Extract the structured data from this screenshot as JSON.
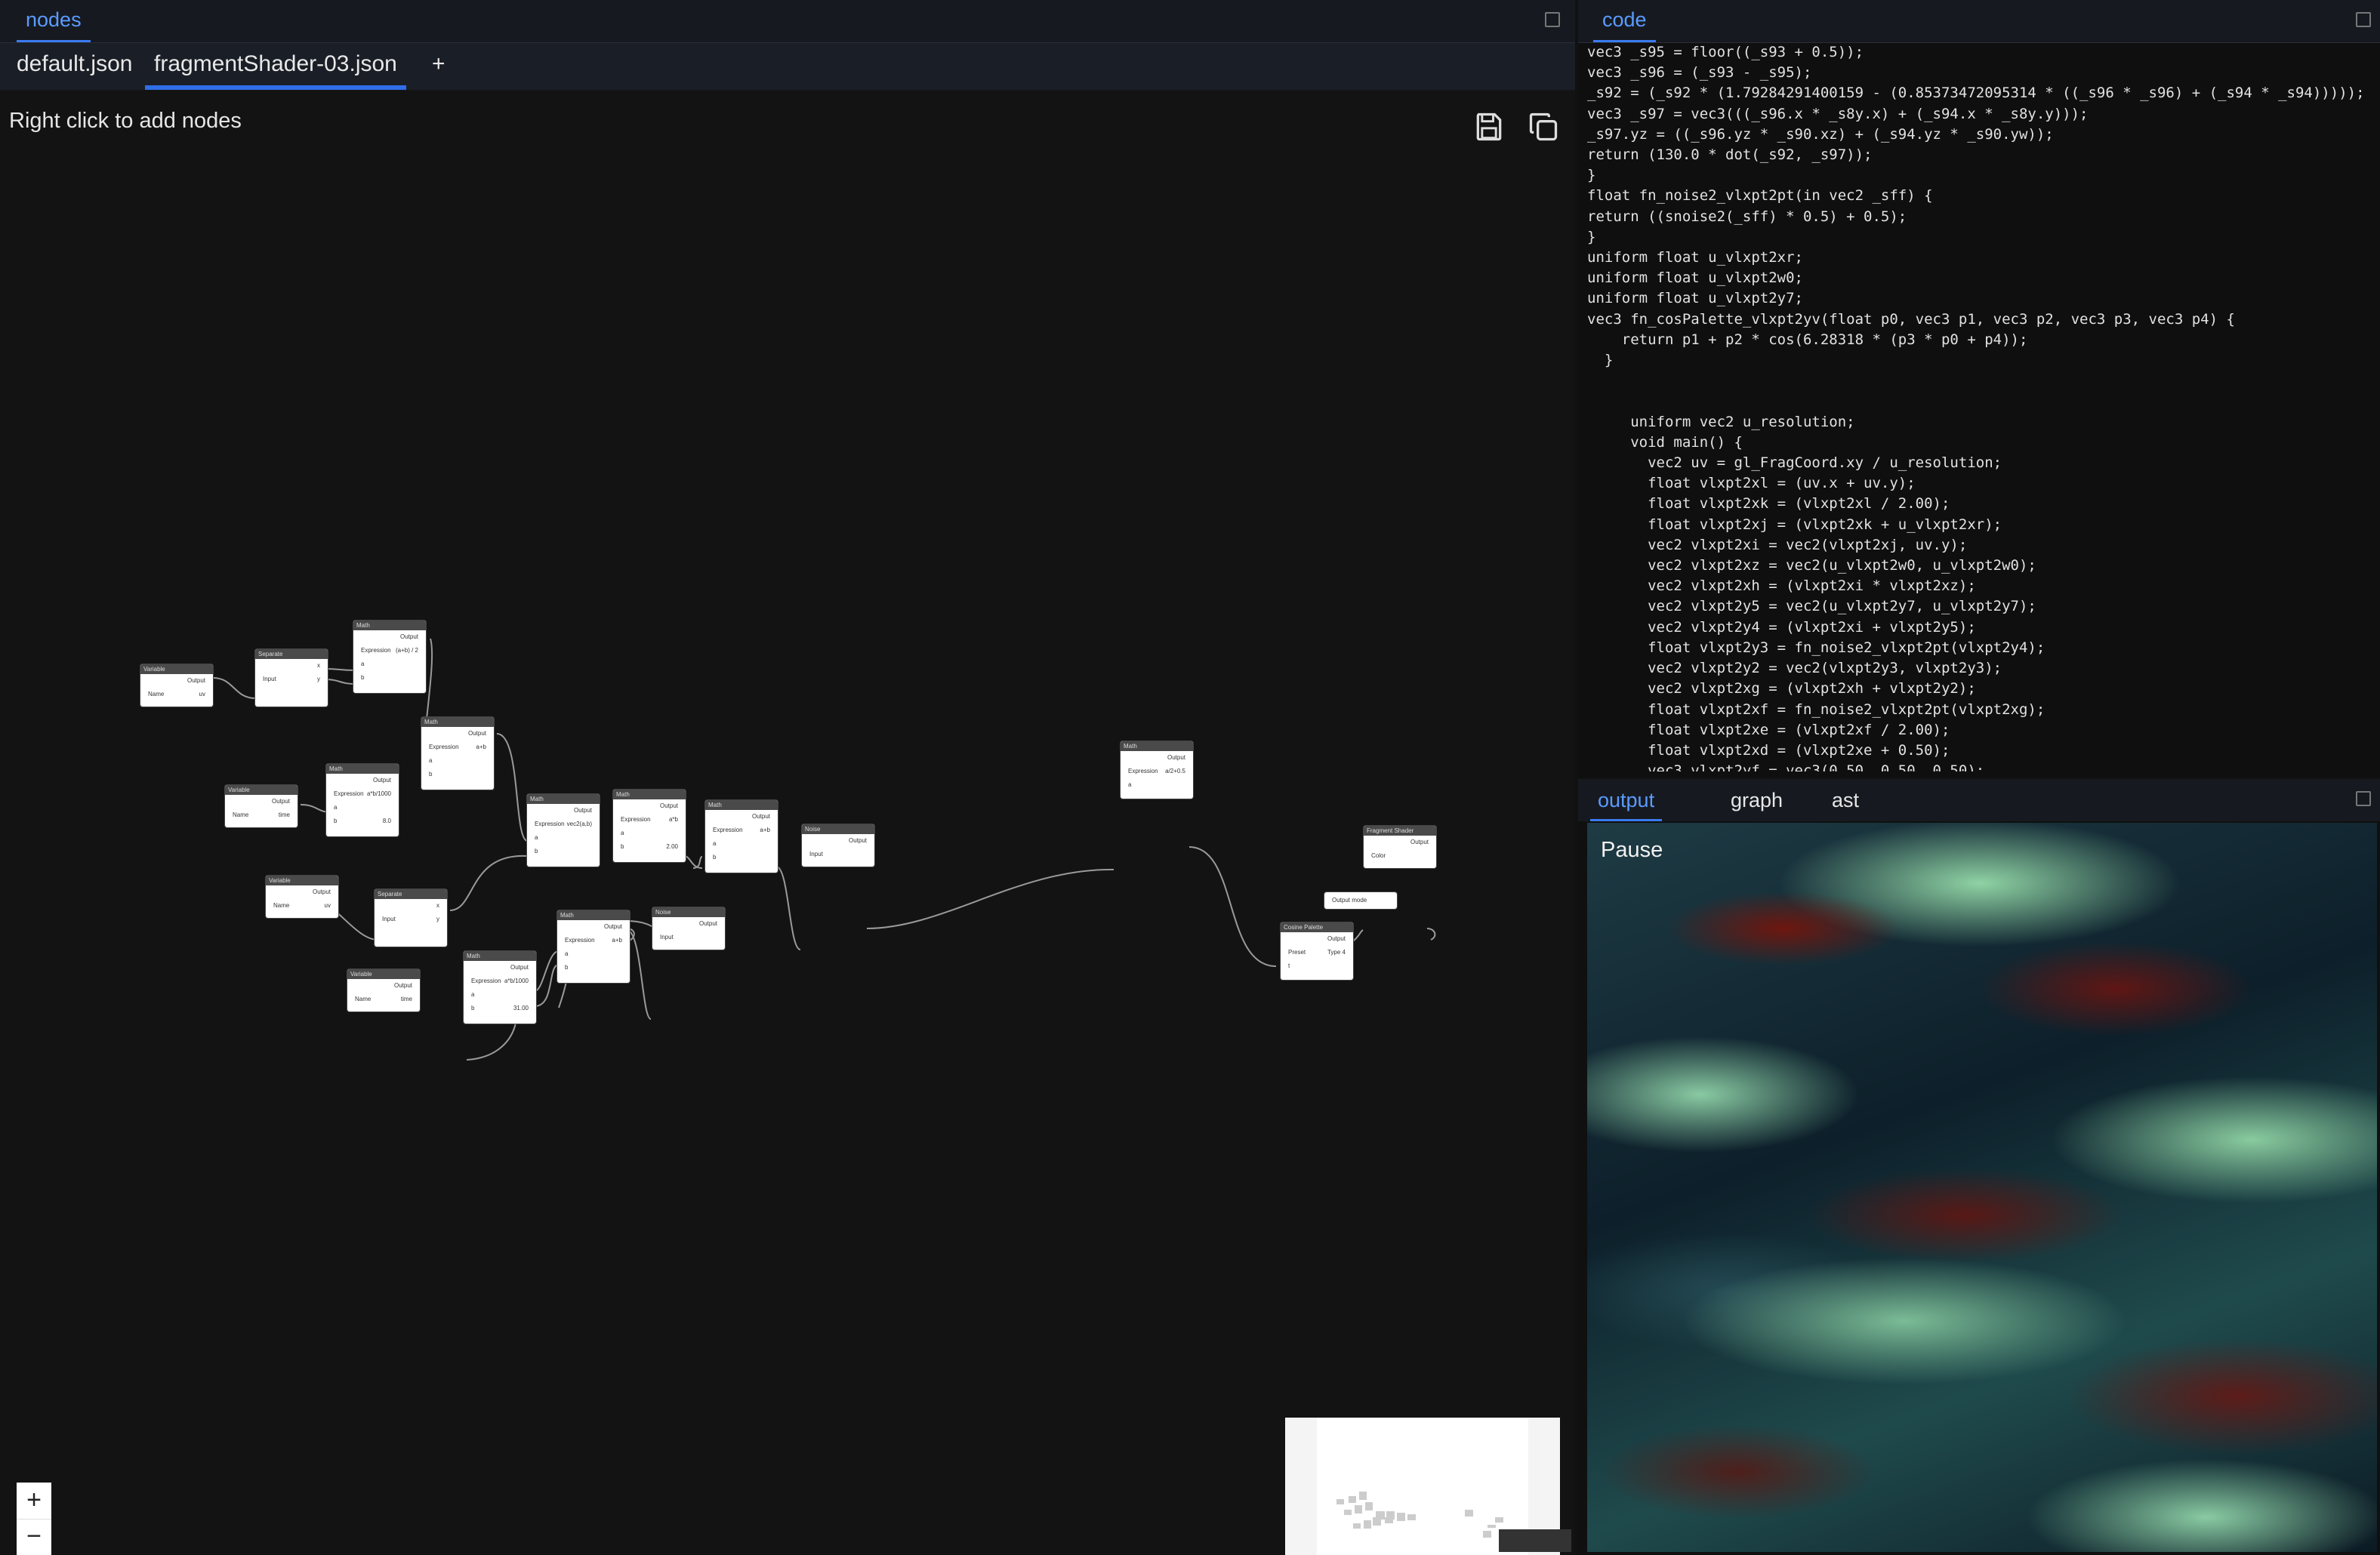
{
  "left_panel": {
    "tab": "nodes"
  },
  "file_tabs": [
    {
      "label": "default.json"
    },
    {
      "label": "fragmentShader-03.json"
    }
  ],
  "add_tab_label": "+",
  "canvas": {
    "hint": "Right click to add nodes"
  },
  "icons": {
    "save": "save-icon",
    "copy": "copy-icon"
  },
  "nodes": [
    {
      "title": "Variable",
      "rows": [
        [
          "",
          "Output"
        ],
        [
          "Name",
          "uv"
        ]
      ]
    },
    {
      "title": "Separate",
      "rows": [
        [
          "",
          "x"
        ],
        [
          "Input",
          "y"
        ]
      ]
    },
    {
      "title": "Math",
      "rows": [
        [
          "",
          "Output"
        ],
        [
          "Expression",
          "(a+b) / 2"
        ],
        [
          "a",
          ""
        ],
        [
          "b",
          ""
        ]
      ]
    },
    {
      "title": "Variable",
      "rows": [
        [
          "",
          "Output"
        ],
        [
          "Name",
          "time"
        ]
      ]
    },
    {
      "title": "Math",
      "rows": [
        [
          "",
          "Output"
        ],
        [
          "Expression",
          "a*b/1000"
        ],
        [
          "a",
          ""
        ],
        [
          "b",
          "8.0"
        ]
      ]
    },
    {
      "title": "Math",
      "rows": [
        [
          "",
          "Output"
        ],
        [
          "Expression",
          "a+b"
        ],
        [
          "a",
          ""
        ],
        [
          "b",
          ""
        ]
      ]
    },
    {
      "title": "Variable",
      "rows": [
        [
          "",
          "Output"
        ],
        [
          "Name",
          "uv"
        ]
      ]
    },
    {
      "title": "Separate",
      "rows": [
        [
          "",
          "x"
        ],
        [
          "Input",
          "y"
        ]
      ]
    },
    {
      "title": "Math",
      "rows": [
        [
          "",
          "Output"
        ],
        [
          "Expression",
          "vec2(a,b)"
        ],
        [
          "a",
          ""
        ],
        [
          "b",
          ""
        ]
      ]
    },
    {
      "title": "Math",
      "rows": [
        [
          "",
          "Output"
        ],
        [
          "Expression",
          "a*b"
        ],
        [
          "a",
          ""
        ],
        [
          "b",
          "2.00"
        ]
      ]
    },
    {
      "title": "Math",
      "rows": [
        [
          "",
          "Output"
        ],
        [
          "Expression",
          "a+b"
        ],
        [
          "a",
          ""
        ],
        [
          "b",
          ""
        ]
      ]
    },
    {
      "title": "Noise",
      "rows": [
        [
          "",
          "Output"
        ],
        [
          "Input",
          ""
        ]
      ]
    },
    {
      "title": "Variable",
      "rows": [
        [
          "",
          "Output"
        ],
        [
          "Name",
          "time"
        ]
      ]
    },
    {
      "title": "Math",
      "rows": [
        [
          "",
          "Output"
        ],
        [
          "Expression",
          "a*b/1000"
        ],
        [
          "a",
          ""
        ],
        [
          "b",
          "31.00"
        ]
      ]
    },
    {
      "title": "Math",
      "rows": [
        [
          "",
          "Output"
        ],
        [
          "Expression",
          "a+b"
        ],
        [
          "a",
          ""
        ],
        [
          "b",
          ""
        ]
      ]
    },
    {
      "title": "Noise",
      "rows": [
        [
          "",
          "Output"
        ],
        [
          "Input",
          ""
        ]
      ]
    },
    {
      "title": "Math",
      "rows": [
        [
          "",
          "Output"
        ],
        [
          "Expression",
          "a/2+0.5"
        ],
        [
          "a",
          ""
        ]
      ]
    },
    {
      "title": "Fragment Shader",
      "rows": [
        [
          "",
          "Output"
        ],
        [
          "Color",
          ""
        ]
      ]
    },
    {
      "title": "",
      "rows": [
        [
          "Output mode",
          ""
        ]
      ]
    },
    {
      "title": "Cosine Palette",
      "rows": [
        [
          "",
          "Output"
        ],
        [
          "Preset",
          "Type 4"
        ],
        [
          "t",
          ""
        ]
      ]
    }
  ],
  "zoom_controls": {
    "zoom_in": "+",
    "zoom_out": "−"
  },
  "code_panel": {
    "tab": "code",
    "lines": [
      "vec3 _s95 = floor((_s93 + 0.5));",
      "vec3 _s96 = (_s93 - _s95);",
      "_s92 = (_s92 * (1.79284291400159 - (0.85373472095314 * ((_s96 * _s96) + (_s94 * _s94)))));",
      "vec3 _s97 = vec3(((_s96.x * _s8y.x) + (_s94.x * _s8y.y)));",
      "_s97.yz = ((_s96.yz * _s90.xz) + (_s94.yz * _s90.yw));",
      "return (130.0 * dot(_s92, _s97));",
      "}",
      "float fn_noise2_vlxpt2pt(in vec2 _sff) {",
      "return ((snoise2(_sff) * 0.5) + 0.5);",
      "}",
      "uniform float u_vlxpt2xr;",
      "uniform float u_vlxpt2w0;",
      "uniform float u_vlxpt2y7;",
      "vec3 fn_cosPalette_vlxpt2yv(float p0, vec3 p1, vec3 p2, vec3 p3, vec3 p4) {",
      "    return p1 + p2 * cos(6.28318 * (p3 * p0 + p4));",
      "  }",
      "",
      "",
      "     uniform vec2 u_resolution;",
      "     void main() {",
      "       vec2 uv = gl_FragCoord.xy / u_resolution;",
      "       float vlxpt2xl = (uv.x + uv.y);",
      "       float vlxpt2xk = (vlxpt2xl / 2.00);",
      "       float vlxpt2xj = (vlxpt2xk + u_vlxpt2xr);",
      "       vec2 vlxpt2xi = vec2(vlxpt2xj, uv.y);",
      "       vec2 vlxpt2xz = vec2(u_vlxpt2w0, u_vlxpt2w0);",
      "       vec2 vlxpt2xh = (vlxpt2xi * vlxpt2xz);",
      "       vec2 vlxpt2y5 = vec2(u_vlxpt2y7, u_vlxpt2y7);",
      "       vec2 vlxpt2y4 = (vlxpt2xi + vlxpt2y5);",
      "       float vlxpt2y3 = fn_noise2_vlxpt2pt(vlxpt2y4);",
      "       vec2 vlxpt2y2 = vec2(vlxpt2y3, vlxpt2y3);",
      "       vec2 vlxpt2xg = (vlxpt2xh + vlxpt2y2);",
      "       float vlxpt2xf = fn_noise2_vlxpt2pt(vlxpt2xg);",
      "       float vlxpt2xe = (vlxpt2xf / 2.00);",
      "       float vlxpt2xd = (vlxpt2xe + 0.50);",
      "       vec3 vlxpt2yf = vec3(0.50, 0.50, 0.50);"
    ]
  },
  "output_panel": {
    "tabs": [
      {
        "label": "output"
      },
      {
        "label": "graph"
      },
      {
        "label": "ast"
      }
    ],
    "pause_label": "Pause"
  }
}
